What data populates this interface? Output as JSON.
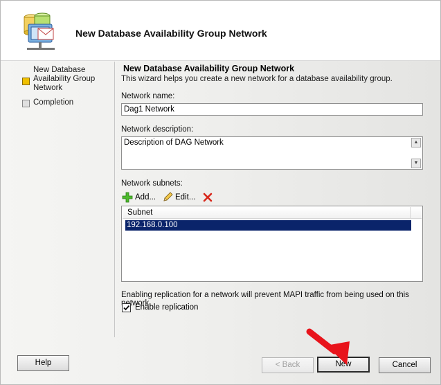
{
  "header": {
    "title": "New Database Availability Group Network"
  },
  "nav": {
    "items": [
      {
        "label": "New Database Availability Group Network",
        "state": "current"
      },
      {
        "label": "Completion",
        "state": "pending"
      }
    ]
  },
  "page": {
    "title": "New Database Availability Group Network",
    "description": "This wizard helps you create a new network for a database availability group.",
    "network_name_label": "Network name:",
    "network_name_value": "Dag1 Network",
    "network_description_label": "Network description:",
    "network_description_value": "Description of DAG Network",
    "subnets_label": "Network subnets:",
    "toolbar": {
      "add_label": "Add...",
      "edit_label": "Edit..."
    },
    "subnets_table": {
      "columns": [
        "Subnet"
      ],
      "rows": [
        {
          "subnet": "192.168.0.100",
          "selected": true
        }
      ]
    },
    "replication_note": "Enabling replication for a network will prevent MAPI traffic from being used on this network.",
    "enable_replication_label": "Enable replication",
    "enable_replication_checked": true
  },
  "buttons": {
    "help": "Help",
    "back": "< Back",
    "new": "New",
    "cancel": "Cancel"
  },
  "colors": {
    "selection": "#0a246a",
    "arrow": "#e8141b",
    "active_step": "#f0c000"
  }
}
